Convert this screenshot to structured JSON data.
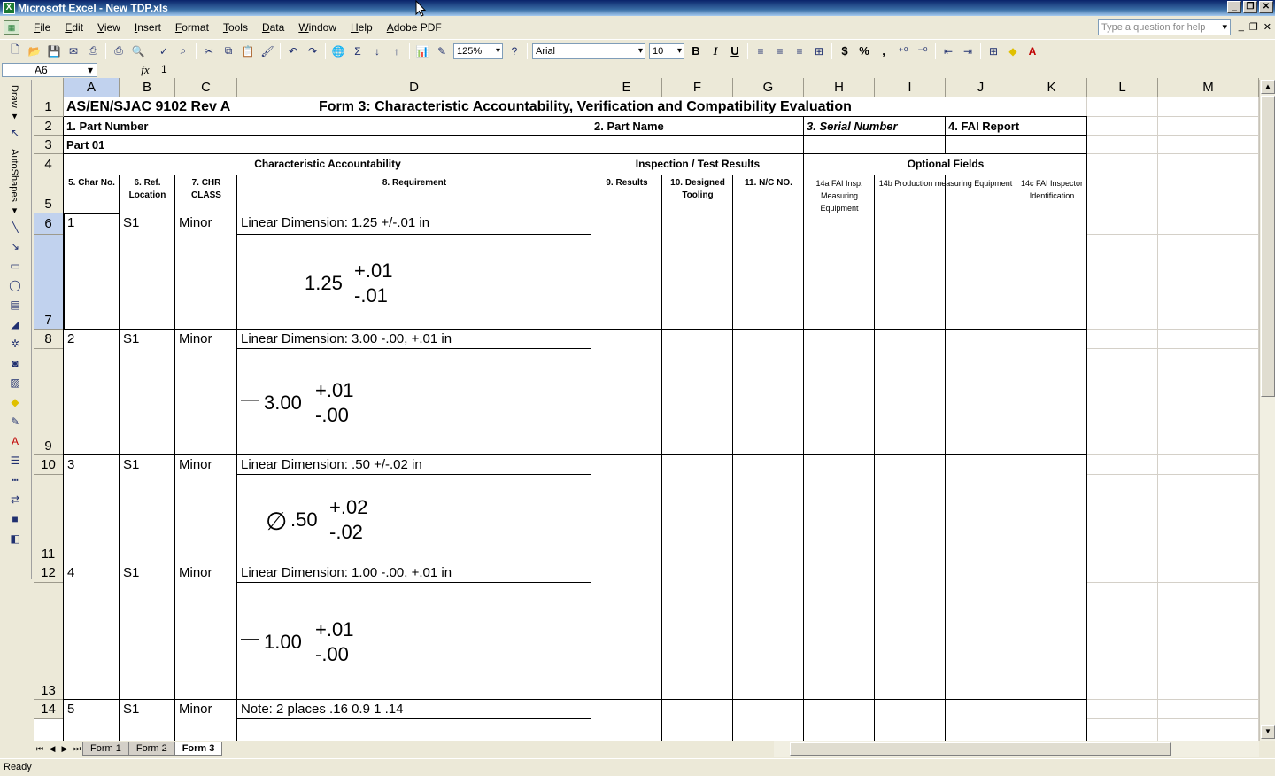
{
  "window": {
    "title": "Microsoft Excel - New TDP.xls"
  },
  "menu": [
    "File",
    "Edit",
    "View",
    "Insert",
    "Format",
    "Tools",
    "Data",
    "Window",
    "Help",
    "Adobe PDF"
  ],
  "help_placeholder": "Type a question for help",
  "toolbar": {
    "zoom": "125%",
    "font": "Arial",
    "font_size": "10",
    "bold": "B",
    "italic": "I",
    "underline": "U",
    "currency": "$",
    "percent": "%",
    "comma": ","
  },
  "formula_bar": {
    "name_box": "A6",
    "fx": "fx",
    "formula": "1"
  },
  "draw_bar": {
    "draw_label": "Draw ▾",
    "autoshapes_label": "AutoShapes ▾"
  },
  "columns": [
    "A",
    "B",
    "C",
    "D",
    "E",
    "F",
    "G",
    "H",
    "I",
    "J",
    "K",
    "L",
    "M"
  ],
  "rows": [
    "1",
    "2",
    "3",
    "4",
    "5",
    "6",
    "7",
    "8",
    "9",
    "10",
    "11",
    "12",
    "13",
    "14"
  ],
  "sheet": {
    "a1": "AS/EN/SJAC 9102 Rev A",
    "title": "Form 3: Characteristic Accountability, Verification and Compatibility Evaluation",
    "part_number_label": "1. Part Number",
    "part_name_label": "2. Part Name",
    "serial_label": "3. Serial Number",
    "fai_label": "4. FAI Report",
    "part_value": "Part 01",
    "sec_char": "Characteristic Accountability",
    "sec_insp": "Inspection / Test Results",
    "sec_opt": "Optional Fields",
    "headers": {
      "char_no": "5. Char No.",
      "ref_loc": "6. Ref. Location",
      "chr_class": "7. CHR CLASS",
      "requirement": "8. Requirement",
      "results": "9. Results",
      "tooling": "10. Designed Tooling",
      "nc": "11. N/C NO.",
      "fai_insp": "14a FAI Insp. Measuring Equipment",
      "prod_equip": "14b Production measuring Equipment",
      "fai_inspector": "14c FAI Inspector Identification"
    },
    "items": [
      {
        "no": "1",
        "loc": "S1",
        "cls": "Minor",
        "req": "Linear Dimension: 1.25  +/-.01 in",
        "prefix": "",
        "nominal": "1.25",
        "upper": "+.01",
        "lower": "-.01"
      },
      {
        "no": "2",
        "loc": "S1",
        "cls": "Minor",
        "req": "Linear Dimension: 3.00  -.00, +.01 in",
        "prefix": "—",
        "nominal": "3.00",
        "upper": "+.01",
        "lower": "-.00"
      },
      {
        "no": "3",
        "loc": "S1",
        "cls": "Minor",
        "req": "Linear Dimension: .50  +/-.02 in",
        "prefix": "∅",
        "nominal": ".50",
        "upper": "+.02",
        "lower": "-.02"
      },
      {
        "no": "4",
        "loc": "S1",
        "cls": "Minor",
        "req": "Linear Dimension: 1.00  -.00, +.01 in",
        "prefix": "—",
        "nominal": "1.00",
        "upper": "+.01",
        "lower": "-.00"
      },
      {
        "no": "5",
        "loc": "S1",
        "cls": "Minor",
        "req": "Note: 2 places .16 0.9 1 .14"
      }
    ]
  },
  "tabs": [
    "Form 1",
    "Form 2",
    "Form 3"
  ],
  "status": "Ready"
}
